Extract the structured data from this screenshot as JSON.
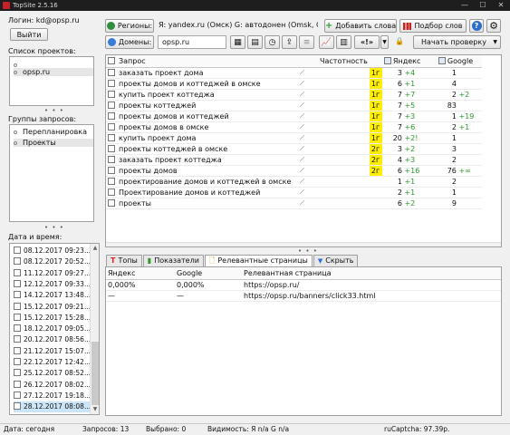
{
  "window": {
    "title": "TopSite 2.5.16",
    "controls": [
      "—",
      "☐",
      "✕"
    ]
  },
  "login": {
    "label": "Логин: kd@opsp.ru",
    "logout_label": "Выйти"
  },
  "projects": {
    "heading": "Список проектов:",
    "items": [
      "",
      "opsp.ru"
    ]
  },
  "groups": {
    "heading": "Группы запросов:",
    "items": [
      "Перепланировка",
      "Проекты"
    ]
  },
  "dates": {
    "heading": "Дата и время:",
    "items": [
      "08.12.2017 09:23...",
      "08.12.2017 20:52...",
      "11.12.2017 09:27...",
      "12.12.2017 09:33...",
      "14.12.2017 13:48...",
      "15.12.2017 09:21...",
      "15.12.2017 15:28...",
      "18.12.2017 09:05...",
      "20.12.2017 08:56...",
      "21.12.2017 15:07...",
      "22.12.2017 12:42...",
      "25.12.2017 08:52...",
      "26.12.2017 08:02...",
      "27.12.2017 19:18...",
      "28.12.2017 08:08..."
    ],
    "selected_index": 14
  },
  "toolbar": {
    "regions_label": "Регионы:",
    "regions_value": "Я: yandex.ru (Омск)  G: автодонен (Omsk, O...",
    "domains_label": "Домены:",
    "domain_value": "opsp.ru",
    "add_words_label": "Добавить слова",
    "word_select_label": "Подбор слов",
    "help_label": "?",
    "start_check_label": "Начать проверку"
  },
  "queries_table": {
    "columns": {
      "query": "Запрос",
      "frequency": "Частотность",
      "yandex": "Яндекс",
      "google": "Google"
    },
    "rows": [
      {
        "query": "заказать проект дома",
        "region": "1г",
        "ya_pos": "3",
        "ya_delta": "+4",
        "go_pos": "1",
        "go_delta": ""
      },
      {
        "query": "проекты домов и коттеджей в омске",
        "region": "1г",
        "ya_pos": "6",
        "ya_delta": "+1",
        "go_pos": "4",
        "go_delta": ""
      },
      {
        "query": "купить проект коттеджа",
        "region": "1г",
        "ya_pos": "7",
        "ya_delta": "+7",
        "go_pos": "2",
        "go_delta": "+2"
      },
      {
        "query": "проекты коттеджей",
        "region": "1г",
        "ya_pos": "7",
        "ya_delta": "+5",
        "go_pos": "83",
        "go_delta": ""
      },
      {
        "query": "проекты домов и коттеджей",
        "region": "1г",
        "ya_pos": "7",
        "ya_delta": "+3",
        "go_pos": "1",
        "go_delta": "+19"
      },
      {
        "query": "проекты домов в омске",
        "region": "1г",
        "ya_pos": "7",
        "ya_delta": "+6",
        "go_pos": "2",
        "go_delta": "+1"
      },
      {
        "query": "купить проект дома",
        "region": "1г",
        "ya_pos": "20",
        "ya_delta": "+2!",
        "go_pos": "1",
        "go_delta": ""
      },
      {
        "query": "проекты коттеджей в омске",
        "region": "2г",
        "ya_pos": "3",
        "ya_delta": "+2",
        "go_pos": "3",
        "go_delta": ""
      },
      {
        "query": "заказать проект коттеджа",
        "region": "2г",
        "ya_pos": "4",
        "ya_delta": "+3",
        "go_pos": "2",
        "go_delta": ""
      },
      {
        "query": "проекты домов",
        "region": "2г",
        "ya_pos": "6",
        "ya_delta": "+16",
        "go_pos": "76",
        "go_delta": "+∞"
      },
      {
        "query": "проектирование домов и коттеджей в омске",
        "region": "",
        "ya_pos": "1",
        "ya_delta": "+1",
        "go_pos": "2",
        "go_delta": ""
      },
      {
        "query": "Проектирование домов и коттеджей",
        "region": "",
        "ya_pos": "2",
        "ya_delta": "+1",
        "go_pos": "1",
        "go_delta": ""
      },
      {
        "query": "проекты",
        "region": "",
        "ya_pos": "6",
        "ya_delta": "+2",
        "go_pos": "9",
        "go_delta": ""
      }
    ]
  },
  "bottom_tabs": {
    "tops": "Топы",
    "indicators": "Показатели",
    "relevant_pages": "Релевантные страницы",
    "hide": "Скрыть"
  },
  "relevant_table": {
    "columns": {
      "yandex": "Яндекс",
      "google": "Google",
      "page": "Релевантная страница"
    },
    "rows": [
      {
        "yandex": "0,000%",
        "google": "0,000%",
        "page": "https://opsp.ru/"
      },
      {
        "yandex": "—",
        "google": "—",
        "page": "https://opsp.ru/banners/click33.html"
      }
    ]
  },
  "status": {
    "date": "Дата: сегодня",
    "queries": "Запросов: 13",
    "selected": "Выбрано: 0",
    "visibility": "Видимость:  Я n/a  G n/a",
    "captcha": "ruCaptcha: 97.39р."
  },
  "colors": {
    "highlight": "#ffee00",
    "positive": "#2a9a2a",
    "selection": "#cce4f7"
  }
}
